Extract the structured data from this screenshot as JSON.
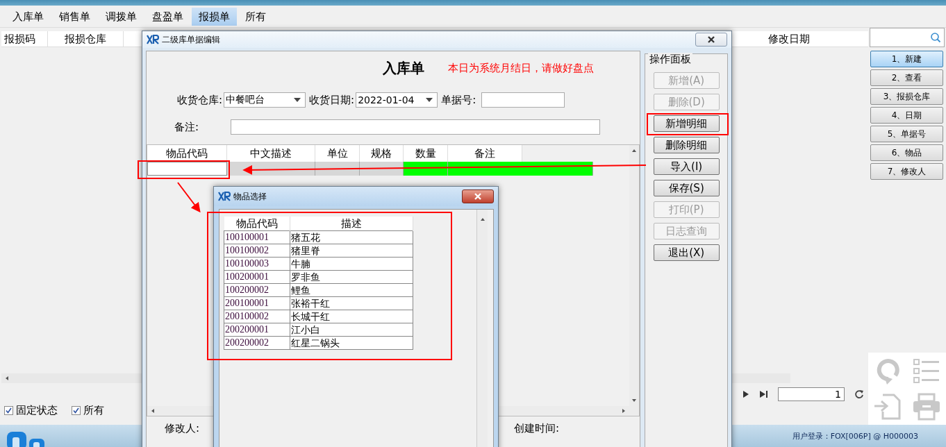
{
  "tabs": [
    {
      "label": "入库单",
      "selected": false
    },
    {
      "label": "销售单",
      "selected": false
    },
    {
      "label": "调拨单",
      "selected": false
    },
    {
      "label": "盘盈单",
      "selected": false
    },
    {
      "label": "报损单",
      "selected": true
    },
    {
      "label": "所有",
      "selected": false
    }
  ],
  "main_grid": {
    "columns": [
      "报损码",
      "报损仓库",
      "修改日期"
    ]
  },
  "sidebar_buttons": [
    {
      "label": "1、新建",
      "selected": true
    },
    {
      "label": "2、查看",
      "selected": false
    },
    {
      "label": "3、报损仓库",
      "selected": false
    },
    {
      "label": "4、日期",
      "selected": false
    },
    {
      "label": "5、单据号",
      "selected": false
    },
    {
      "label": "6、物品",
      "selected": false
    },
    {
      "label": "7、修改人",
      "selected": false
    }
  ],
  "options": [
    {
      "label": "固定状态",
      "checked": true
    },
    {
      "label": "所有",
      "checked": true
    }
  ],
  "pager": {
    "page": "1"
  },
  "status_bar": {
    "text": "用户登录：FOX[006P] @ H000003"
  },
  "edit_dialog": {
    "title": "二级库单据编辑",
    "heading": "入库单",
    "notice": "本日为系统月结日，请做好盘点",
    "fields": [
      {
        "label": "收货仓库:",
        "value": "中餐吧台",
        "kind": "dropdown"
      },
      {
        "label": "收货日期:",
        "value": "2022-01-04",
        "kind": "dropdown"
      },
      {
        "label": "单据号:",
        "kind": "text"
      }
    ],
    "remark_label": "备注:",
    "detail_columns": [
      {
        "label": "物品代码",
        "kind": "input"
      },
      {
        "label": "中文描述",
        "kind": "readonly"
      },
      {
        "label": "单位",
        "kind": "readonly"
      },
      {
        "label": "规格",
        "kind": "readonly"
      },
      {
        "label": "数量",
        "kind": "editable"
      },
      {
        "label": "备注",
        "kind": "editable"
      }
    ],
    "footer": [
      "修改人:",
      "创建时间:"
    ],
    "panel": {
      "title": "操作面板",
      "buttons": [
        {
          "label": "新增(A)",
          "disabled": true
        },
        {
          "label": "删除(D)",
          "disabled": true
        },
        {
          "label": "新增明细",
          "disabled": false
        },
        {
          "label": "删除明细",
          "disabled": false
        },
        {
          "label": "导入(I)",
          "disabled": false
        },
        {
          "label": "保存(S)",
          "disabled": false
        },
        {
          "label": "打印(P)",
          "disabled": true
        },
        {
          "label": "日志查询",
          "disabled": true
        },
        {
          "label": "退出(X)",
          "disabled": false
        }
      ]
    }
  },
  "picker_dialog": {
    "title": "物品选择",
    "columns": [
      "物品代码",
      "描述"
    ],
    "rows": [
      {
        "code": "100100001",
        "name": "猪五花"
      },
      {
        "code": "100100002",
        "name": "猪里脊"
      },
      {
        "code": "100100003",
        "name": "牛腩"
      },
      {
        "code": "100200001",
        "name": "罗非鱼"
      },
      {
        "code": "100200002",
        "name": "鲤鱼"
      },
      {
        "code": "200100001",
        "name": "张裕干红"
      },
      {
        "code": "200100002",
        "name": "长城干红"
      },
      {
        "code": "200200001",
        "name": "江小白"
      },
      {
        "code": "200200002",
        "name": "红星二锅头"
      }
    ]
  }
}
